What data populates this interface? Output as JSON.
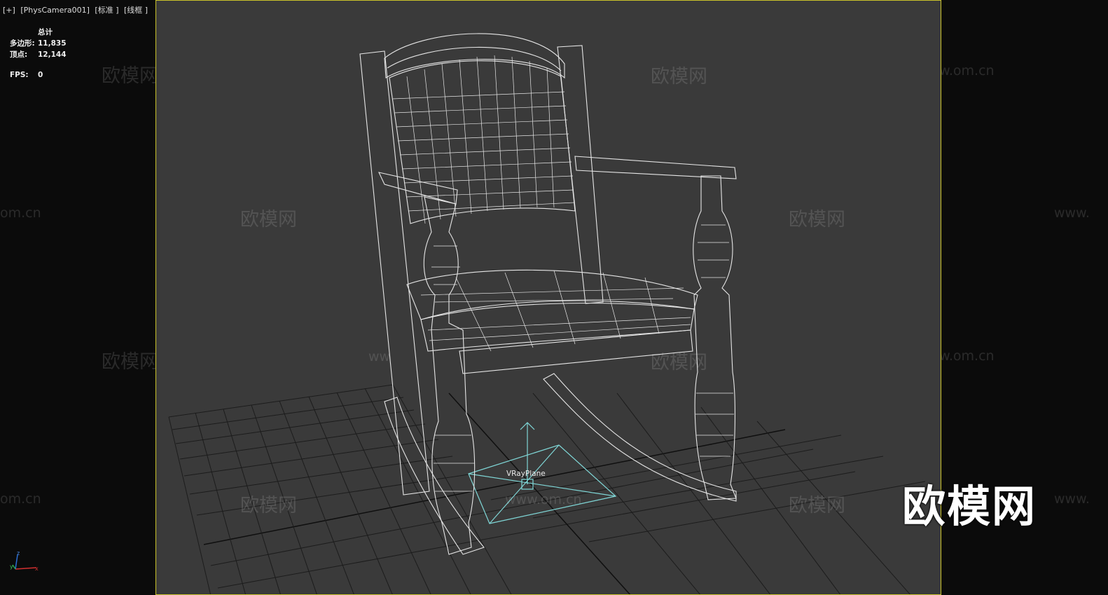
{
  "viewport": {
    "labels": [
      "[+]",
      "[PhysCamera001]",
      "[标准 ]",
      "[线框 ]"
    ]
  },
  "stats": {
    "total_label": "总计",
    "polys_label": "多边形:",
    "polys_value": "11,835",
    "verts_label": "顶点:",
    "verts_value": "12,144",
    "fps_label": "FPS:",
    "fps_value": "0"
  },
  "scene": {
    "object_label": "VRayPlane"
  },
  "watermark": {
    "brand": "欧模网",
    "url": "www.om.cn",
    "url_fragment_left": "om.cn",
    "url_fragment_right": "www.",
    "fragment_ww": "ww"
  },
  "axis": {
    "x": "x",
    "y": "y",
    "z": "z"
  },
  "colors": {
    "viewport_bg": "#3a3a3a",
    "active_border": "#c9c22a",
    "wire": "#e8e8e8",
    "helper": "#7fd6d6",
    "grid": "#1a1a1a"
  }
}
